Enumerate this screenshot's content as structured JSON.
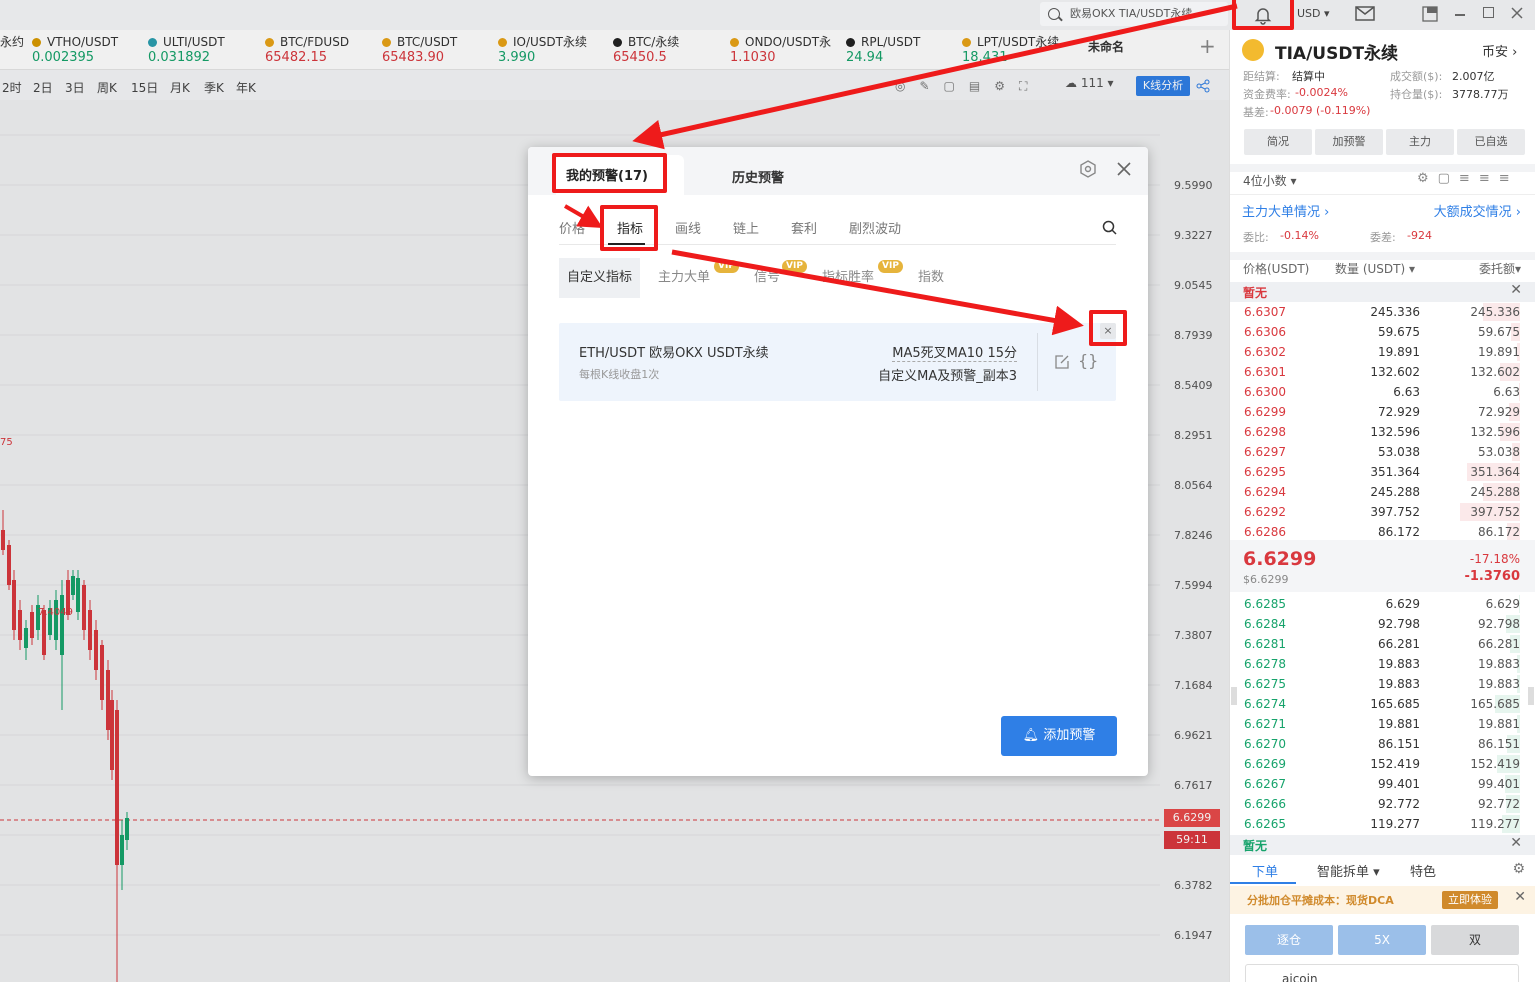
{
  "topbar": {
    "search_text": "欧易OKX TIA/USDT永续",
    "currency": "USD ▾"
  },
  "ticker": [
    {
      "name": "VTHO/USDT",
      "value": "0.002395",
      "color": "#16a36b",
      "dot": "#d99a00"
    },
    {
      "name": "ULTI/USDT",
      "value": "0.031892",
      "color": "#16a36b",
      "dot": "#2b9fb0"
    },
    {
      "name": "BTC/FDUSD",
      "value": "65482.15",
      "color": "#d9383e",
      "dot": "#e8a317"
    },
    {
      "name": "BTC/USDT",
      "value": "65483.90",
      "color": "#d9383e",
      "dot": "#e8a317"
    },
    {
      "name": "IO/USDT永续",
      "value": "3.990",
      "color": "#16a36b",
      "dot": "#e8a317"
    },
    {
      "name": "BTC/永续",
      "value": "65450.5",
      "color": "#d9383e",
      "dot": "#222"
    },
    {
      "name": "ONDO/USDT永",
      "value": "1.1030",
      "color": "#d9383e",
      "dot": "#e8a317"
    },
    {
      "name": "RPL/USDT",
      "value": "24.94",
      "color": "#16a36b",
      "dot": "#222"
    },
    {
      "name": "LPT/USDT永续",
      "value": "18.431",
      "color": "#16a36b",
      "dot": "#e8a317"
    }
  ],
  "ticker_extra": {
    "unnamed": "未命名",
    "plus": "+",
    "left_cut": "永约"
  },
  "periods": [
    "2时",
    "2日",
    "3日",
    "周K",
    "15日",
    "月K",
    "季K",
    "年K"
  ],
  "toolbar": {
    "cloud": "111",
    "kline": "K线分析"
  },
  "yaxis": [
    "9.5990",
    "9.3227",
    "9.0545",
    "8.7939",
    "8.5409",
    "8.2951",
    "8.0564",
    "7.8246",
    "7.5994",
    "7.3807",
    "7.1684",
    "6.9621",
    "6.7617",
    "6.6299",
    "59:11",
    "6.3782",
    "6.1947"
  ],
  "chart_labels": {
    "left_num": "75",
    "mid_price": "7.4049"
  },
  "dialog": {
    "tab_my": "我的预警(17)",
    "tab_history": "历史预警",
    "sub_tabs": [
      "价格",
      "指标",
      "画线",
      "链上",
      "套利",
      "剧烈波动"
    ],
    "chips": [
      "自定义指标",
      "主力大单",
      "信号",
      "指标胜率",
      "指数"
    ],
    "vip": "VIP",
    "card": {
      "pair": "ETH/USDT  欧易OKX USDT永续",
      "freq": "每根K线收盘1次",
      "condition": "MA5死叉MA10 15分",
      "name": "自定义MA及预警_副本3"
    },
    "add_button": "添加预警"
  },
  "right": {
    "symbol": "TIA/USDT永续",
    "exchange": "币安",
    "stats": [
      {
        "k": "距结算:",
        "v": "结算中",
        "k2": "成交额($):",
        "v2": "2.007亿"
      },
      {
        "k": "资金费率:",
        "v": "-0.0024%",
        "k2": "持仓量($):",
        "v2": "3778.77万"
      },
      {
        "k": "基差:",
        "v": "-0.0079 (-0.119%)",
        "k2": "",
        "v2": ""
      }
    ],
    "buttons": [
      "简况",
      "加预警",
      "主力",
      "已自选"
    ],
    "decimals": "4位小数 ▾",
    "links": [
      "主力大单情况 ›",
      "大额成交情况 ›"
    ],
    "ratio": {
      "k": "委比:",
      "v": "-0.14%",
      "k2": "委差:",
      "v2": "-924"
    },
    "headers": [
      "价格(USDT)",
      "数量 (USDT) ▾",
      "委托额▾"
    ],
    "none": "暂无",
    "asks": [
      [
        "6.6307",
        "245.336",
        "245.336"
      ],
      [
        "6.6306",
        "59.675",
        "59.675"
      ],
      [
        "6.6302",
        "19.891",
        "19.891"
      ],
      [
        "6.6301",
        "132.602",
        "132.602"
      ],
      [
        "6.6300",
        "6.63",
        "6.63"
      ],
      [
        "6.6299",
        "72.929",
        "72.929"
      ],
      [
        "6.6298",
        "132.596",
        "132.596"
      ],
      [
        "6.6297",
        "53.038",
        "53.038"
      ],
      [
        "6.6295",
        "351.364",
        "351.364"
      ],
      [
        "6.6294",
        "245.288",
        "245.288"
      ],
      [
        "6.6292",
        "397.752",
        "397.752"
      ],
      [
        "6.6286",
        "86.172",
        "86.172"
      ]
    ],
    "last": {
      "price": "6.6299",
      "usd": "$6.6299",
      "pct": "-17.18%",
      "chg": "-1.3760"
    },
    "bids": [
      [
        "6.6285",
        "6.629",
        "6.629"
      ],
      [
        "6.6284",
        "92.798",
        "92.798"
      ],
      [
        "6.6281",
        "66.281",
        "66.281"
      ],
      [
        "6.6278",
        "19.883",
        "19.883"
      ],
      [
        "6.6275",
        "19.883",
        "19.883"
      ],
      [
        "6.6274",
        "165.685",
        "165.685"
      ],
      [
        "6.6271",
        "19.881",
        "19.881"
      ],
      [
        "6.6270",
        "86.151",
        "86.151"
      ],
      [
        "6.6269",
        "152.419",
        "152.419"
      ],
      [
        "6.6267",
        "99.401",
        "99.401"
      ],
      [
        "6.6266",
        "92.772",
        "92.772"
      ],
      [
        "6.6265",
        "119.277",
        "119.277"
      ]
    ],
    "order_tabs": [
      "下单",
      "智能拆单 ▾",
      "特色"
    ],
    "promo": "分批加仓平摊成本：现货DCA",
    "promo_btn": "立即体验",
    "mode": [
      "逐仓",
      "5X",
      "双"
    ],
    "account": "aicoin"
  },
  "colors": {
    "up": "#16a36b",
    "down": "#d9383e",
    "accent": "#2f7fe6",
    "annotate": "#ee1b1b"
  }
}
